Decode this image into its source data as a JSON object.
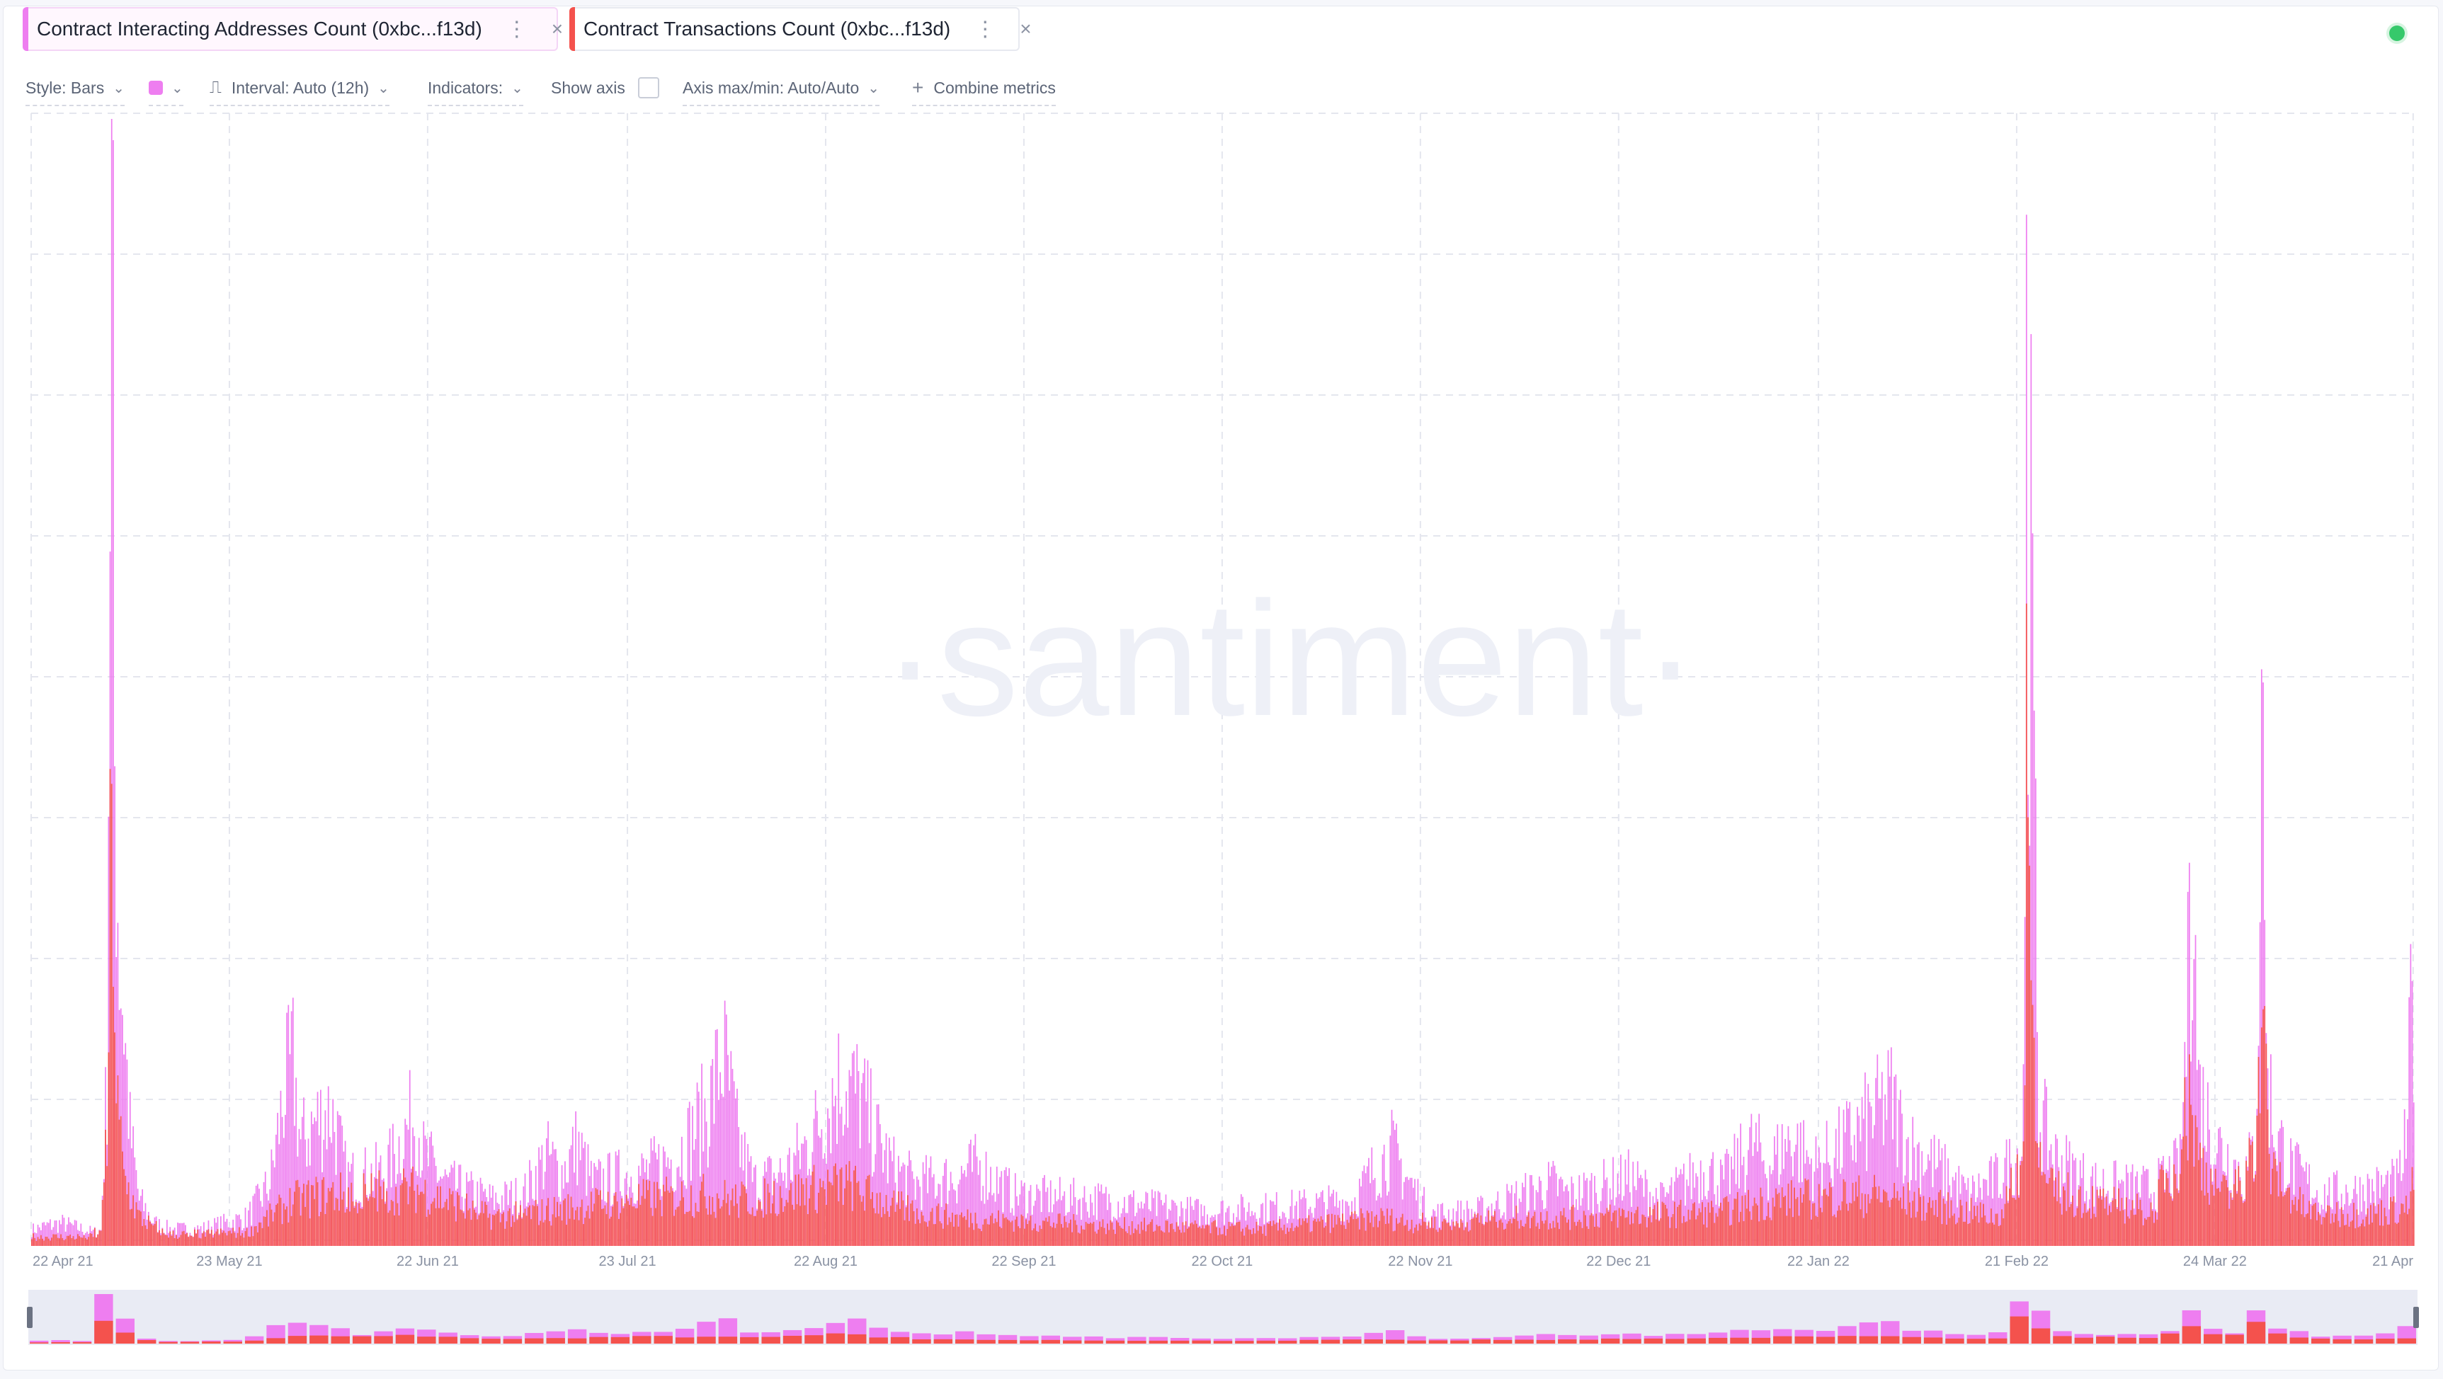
{
  "tabs": [
    {
      "label": "Contract Interacting Addresses Count (0xbc...f13d)",
      "color": "#ee7ef0"
    },
    {
      "label": "Contract Transactions Count (0xbc...f13d)",
      "color": "#f4524d"
    }
  ],
  "icons": {
    "menu": "⋮",
    "close": "×",
    "chevron": "⌄",
    "interval": "⎍",
    "plus": "+"
  },
  "toolbar": {
    "style": "Style: Bars",
    "interval": "Interval: Auto (12h)",
    "indicators": "Indicators:",
    "show_axis": "Show axis",
    "axis_minmax": "Axis max/min: Auto/Auto",
    "combine": "Combine metrics"
  },
  "watermark": "·santiment·",
  "chart_data": {
    "type": "bar",
    "x_labels": [
      "22 Apr 21",
      "23 May 21",
      "22 Jun 21",
      "23 Jul 21",
      "22 Aug 21",
      "22 Sep 21",
      "22 Oct 21",
      "22 Nov 21",
      "22 Dec 21",
      "22 Jan 22",
      "21 Feb 22",
      "24 Mar 22",
      "21 Apr"
    ],
    "interval": "12h",
    "ylim": [
      0,
      1000
    ],
    "grid": true,
    "series": [
      {
        "name": "Contract Interacting Addresses Count (0xbc...f13d)",
        "color": "#ee7ef0",
        "anchors": [
          [
            0,
            14
          ],
          [
            10,
            18
          ],
          [
            20,
            20
          ],
          [
            30,
            16
          ],
          [
            40,
            12
          ],
          [
            45,
            14
          ],
          [
            49,
            150
          ],
          [
            52,
            1000
          ],
          [
            54,
            420
          ],
          [
            57,
            260
          ],
          [
            60,
            200
          ],
          [
            64,
            100
          ],
          [
            70,
            40
          ],
          [
            80,
            20
          ],
          [
            90,
            15
          ],
          [
            110,
            15
          ],
          [
            140,
            25
          ],
          [
            155,
            55
          ],
          [
            165,
            140
          ],
          [
            170,
            160
          ],
          [
            175,
            90
          ],
          [
            185,
            110
          ],
          [
            195,
            120
          ],
          [
            205,
            60
          ],
          [
            230,
            65
          ],
          [
            245,
            105
          ],
          [
            250,
            120
          ],
          [
            255,
            80
          ],
          [
            270,
            55
          ],
          [
            300,
            40
          ],
          [
            320,
            45
          ],
          [
            335,
            80
          ],
          [
            345,
            65
          ],
          [
            355,
            90
          ],
          [
            365,
            55
          ],
          [
            380,
            60
          ],
          [
            400,
            65
          ],
          [
            420,
            80
          ],
          [
            440,
            120
          ],
          [
            450,
            170
          ],
          [
            460,
            90
          ],
          [
            470,
            55
          ],
          [
            490,
            65
          ],
          [
            505,
            90
          ],
          [
            520,
            130
          ],
          [
            527,
            150
          ],
          [
            540,
            130
          ],
          [
            550,
            95
          ],
          [
            560,
            70
          ],
          [
            575,
            55
          ],
          [
            600,
            60
          ],
          [
            615,
            70
          ],
          [
            640,
            45
          ],
          [
            700,
            40
          ],
          [
            760,
            30
          ],
          [
            820,
            35
          ],
          [
            860,
            40
          ],
          [
            875,
            70
          ],
          [
            885,
            85
          ],
          [
            895,
            60
          ],
          [
            910,
            28
          ],
          [
            940,
            30
          ],
          [
            970,
            45
          ],
          [
            990,
            55
          ],
          [
            1000,
            45
          ],
          [
            1040,
            60
          ],
          [
            1060,
            40
          ],
          [
            1090,
            70
          ],
          [
            1100,
            55
          ],
          [
            1120,
            90
          ],
          [
            1130,
            70
          ],
          [
            1145,
            95
          ],
          [
            1160,
            70
          ],
          [
            1175,
            85
          ],
          [
            1195,
            110
          ],
          [
            1210,
            130
          ],
          [
            1220,
            90
          ],
          [
            1240,
            70
          ],
          [
            1260,
            45
          ],
          [
            1280,
            60
          ],
          [
            1295,
            85
          ],
          [
            1300,
            640
          ],
          [
            1302,
            500
          ],
          [
            1304,
            300
          ],
          [
            1306,
            120
          ],
          [
            1315,
            80
          ],
          [
            1340,
            55
          ],
          [
            1380,
            50
          ],
          [
            1398,
            70
          ],
          [
            1404,
            250
          ],
          [
            1406,
            330
          ],
          [
            1410,
            140
          ],
          [
            1420,
            95
          ],
          [
            1440,
            60
          ],
          [
            1447,
            90
          ],
          [
            1452,
            470
          ],
          [
            1454,
            160
          ],
          [
            1460,
            100
          ],
          [
            1470,
            70
          ],
          [
            1490,
            45
          ],
          [
            1520,
            50
          ],
          [
            1540,
            55
          ],
          [
            1546,
            100
          ],
          [
            1549,
            260
          ],
          [
            1550,
            200
          ]
        ],
        "spikes": [
          [
            52,
            1000
          ],
          [
            1298,
            915
          ],
          [
            1404,
            340
          ],
          [
            1452,
            500
          ],
          [
            1549,
            235
          ]
        ]
      },
      {
        "name": "Contract Transactions Count (0xbc...f13d)",
        "color": "#f4524d",
        "anchors": [
          [
            0,
            8
          ],
          [
            40,
            8
          ],
          [
            49,
            80
          ],
          [
            52,
            420
          ],
          [
            55,
            130
          ],
          [
            60,
            60
          ],
          [
            70,
            25
          ],
          [
            90,
            10
          ],
          [
            140,
            12
          ],
          [
            170,
            40
          ],
          [
            190,
            45
          ],
          [
            250,
            50
          ],
          [
            300,
            25
          ],
          [
            360,
            35
          ],
          [
            380,
            40
          ],
          [
            440,
            45
          ],
          [
            460,
            40
          ],
          [
            530,
            55
          ],
          [
            560,
            35
          ],
          [
            600,
            25
          ],
          [
            700,
            18
          ],
          [
            800,
            15
          ],
          [
            880,
            25
          ],
          [
            900,
            20
          ],
          [
            960,
            25
          ],
          [
            1000,
            25
          ],
          [
            1100,
            30
          ],
          [
            1130,
            40
          ],
          [
            1200,
            45
          ],
          [
            1220,
            40
          ],
          [
            1280,
            25
          ],
          [
            1296,
            90
          ],
          [
            1299,
            565
          ],
          [
            1302,
            190
          ],
          [
            1310,
            50
          ],
          [
            1380,
            30
          ],
          [
            1404,
            120
          ],
          [
            1410,
            80
          ],
          [
            1430,
            40
          ],
          [
            1452,
            205
          ],
          [
            1456,
            70
          ],
          [
            1480,
            30
          ],
          [
            1520,
            28
          ],
          [
            1550,
            35
          ]
        ],
        "spikes": [
          [
            52,
            410
          ],
          [
            1298,
            570
          ],
          [
            1404,
            170
          ],
          [
            1452,
            210
          ],
          [
            1549,
            70
          ]
        ]
      }
    ],
    "navigator": {
      "type": "bar",
      "series": [
        {
          "name": "Contract Interacting Addresses Count (0xbc...f13d)",
          "color": "#ee7ef0"
        },
        {
          "name": "Contract Transactions Count (0xbc...f13d)",
          "color": "#f4524d"
        }
      ]
    }
  }
}
